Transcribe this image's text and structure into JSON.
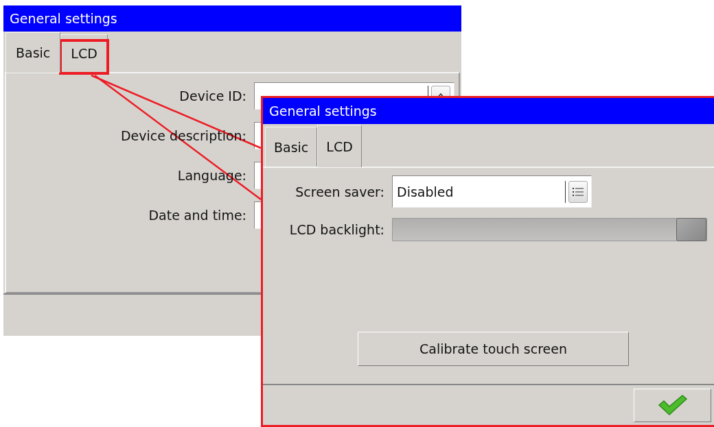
{
  "back_window": {
    "title": "General settings",
    "tabs": [
      {
        "label": "Basic",
        "selected": true,
        "highlighted": false
      },
      {
        "label": "LCD",
        "selected": false,
        "highlighted": true
      }
    ],
    "fields": [
      {
        "label": "Device ID:",
        "kind": "spin"
      },
      {
        "label": "Device description:",
        "kind": "text"
      },
      {
        "label": "Language:",
        "kind": "text"
      },
      {
        "label": "Date and time:",
        "kind": "text"
      }
    ]
  },
  "front_window": {
    "title": "General settings",
    "tabs": [
      {
        "label": "Basic",
        "selected": false
      },
      {
        "label": "LCD",
        "selected": true
      }
    ],
    "screen_saver": {
      "label": "Screen saver:",
      "value": "Disabled"
    },
    "backlight": {
      "label": "LCD backlight:",
      "level": 1
    },
    "calibrate_button": "Calibrate touch screen"
  }
}
